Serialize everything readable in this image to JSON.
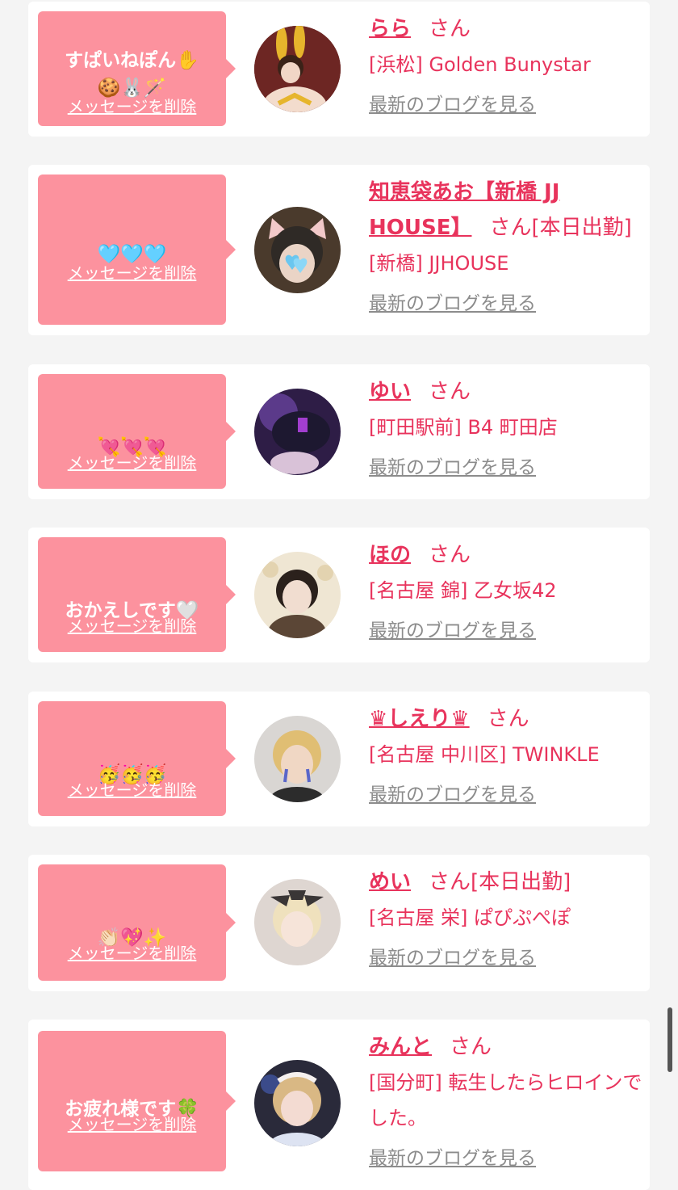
{
  "colors": {
    "bubble": "#fc929e",
    "pink_text": "#e8335c",
    "gray_link": "#8c8c8c",
    "page_bg": "#f4f4f4"
  },
  "common": {
    "delete_label": "メッセージを削除",
    "blog_label": "最新のブログを見る",
    "san": "さん"
  },
  "items": [
    {
      "message": "すぱいねぽん",
      "emoji": "✋\n🍪🐰🪄",
      "name": "らら",
      "tag": "",
      "shop": "[浜松] Golden Bunystar",
      "avatar_icon": "avatar-bunny-photo"
    },
    {
      "message": "",
      "emoji": "🩵🩵🩵",
      "name": "知恵袋あお【新橋 JJ HOUSE】",
      "tag": "[本日出勤]",
      "shop": "[新橋] JJHOUSE",
      "avatar_icon": "avatar-cat-ears-photo"
    },
    {
      "message": "",
      "emoji": "💘💘💘",
      "name": "ゆい",
      "tag": "",
      "shop": "[町田駅前] B4 町田店",
      "avatar_icon": "avatar-dark-photo"
    },
    {
      "message": "おかえしです",
      "emoji": "🤍",
      "name": "ほの",
      "tag": "",
      "shop": "[名古屋 錦] 乙女坂42",
      "avatar_icon": "avatar-portrait-photo"
    },
    {
      "message": "",
      "emoji": "🥳🥳🥳",
      "name": "♛しえり♛",
      "tag": "",
      "shop": "[名古屋 中川区] TWINKLE",
      "avatar_icon": "avatar-blonde-photo"
    },
    {
      "message": "",
      "emoji": "👏🏻💖✨",
      "name": "めい",
      "tag": "[本日出勤]",
      "shop": "[名古屋 栄] ぱぴぷぺぽ",
      "avatar_icon": "avatar-bow-photo"
    },
    {
      "message": "お疲れ様です",
      "emoji": "🍀",
      "name": "みんと",
      "tag": "",
      "shop": "[国分町] 転生したらヒロインでした。",
      "avatar_icon": "avatar-maid-photo"
    }
  ]
}
